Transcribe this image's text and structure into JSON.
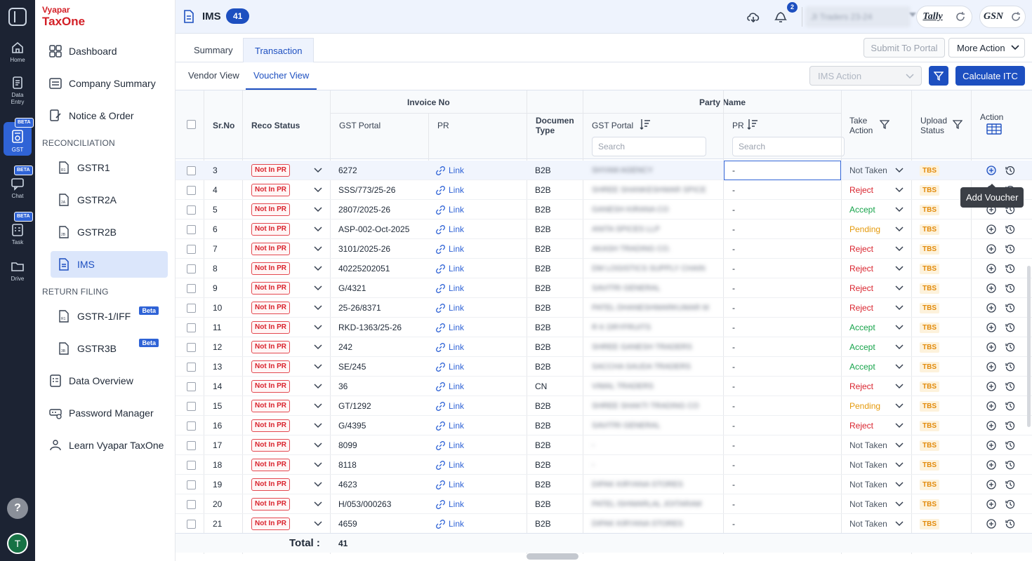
{
  "rail": {
    "items": [
      {
        "label": "Home",
        "icon": "home-icon"
      },
      {
        "label": "Data Entry",
        "icon": "data-entry-icon"
      },
      {
        "label": "GST",
        "icon": "gst-icon",
        "badge": "BETA"
      },
      {
        "label": "Chat",
        "icon": "chat-icon",
        "badge": "BETA"
      },
      {
        "label": "Task",
        "icon": "task-icon",
        "badge": "BETA"
      },
      {
        "label": "Drive",
        "icon": "drive-icon"
      }
    ],
    "help": "?",
    "avatar": "T"
  },
  "brand": {
    "line1": "Vyapar",
    "line2": "TaxOne"
  },
  "sidebar": {
    "dashboard": "Dashboard",
    "company_summary": "Company Summary",
    "notice_order": "Notice & Order",
    "reconciliation": "RECONCILIATION",
    "gstr1": "GSTR1",
    "gstr2a": "GSTR2A",
    "gstr2b": "GSTR2B",
    "ims": "IMS",
    "return_filing": "RETURN FILING",
    "gstr1_iff": "GSTR-1/IFF",
    "gstr3b": "GSTR3B",
    "beta": "Beta",
    "data_overview": "Data Overview",
    "password_manager": "Password Manager",
    "learn": "Learn Vyapar TaxOne"
  },
  "topbar": {
    "title": "IMS",
    "count": "41",
    "notifications": "2",
    "company": "JI Traders 23-24",
    "tally": "Tally",
    "gsn": "GSN"
  },
  "tabs": {
    "summary": "Summary",
    "transaction": "Transaction"
  },
  "actions": {
    "submit": "Submit To Portal",
    "more": "More Action",
    "ims_action": "IMS Action",
    "calculate": "Calculate ITC"
  },
  "views": {
    "vendor": "Vendor View",
    "voucher": "Voucher View"
  },
  "columns": {
    "srno": "Sr.No",
    "reco_status": "Reco Status",
    "invoice_no": "Invoice No",
    "gst_portal": "GST Portal",
    "pr": "PR",
    "doc_type_1": "Documen",
    "doc_type_2": "Type",
    "party_name": "Party Name",
    "take_action_1": "Take",
    "take_action_2": "Action",
    "upload_status_1": "Upload",
    "upload_status_2": "Status",
    "action": "Action",
    "search_placeholder": "Search"
  },
  "rows": [
    {
      "sr": "3",
      "reco": "Not In PR",
      "invoice": "6272",
      "pr": "Link",
      "doc": "B2B",
      "party": "SHYAM AGENCY",
      "party_pr": "-",
      "action": "Not Taken",
      "upload": "TBS"
    },
    {
      "sr": "4",
      "reco": "Not In PR",
      "invoice": "SSS/773/25-26",
      "pr": "Link",
      "doc": "B2B",
      "party": "SHREE SHANKESHWAR SPICE",
      "party_pr": "-",
      "action": "Reject",
      "upload": "TBS"
    },
    {
      "sr": "5",
      "reco": "Not In PR",
      "invoice": "2807/2025-26",
      "pr": "Link",
      "doc": "B2B",
      "party": "GANESH KIRANA CO",
      "party_pr": "-",
      "action": "Accept",
      "upload": "TBS"
    },
    {
      "sr": "6",
      "reco": "Not In PR",
      "invoice": "ASP-002-Oct-2025",
      "pr": "Link",
      "doc": "B2B",
      "party": "ANITA SPICES LLP",
      "party_pr": "-",
      "action": "Pending",
      "upload": "TBS"
    },
    {
      "sr": "7",
      "reco": "Not In PR",
      "invoice": "3101/2025-26",
      "pr": "Link",
      "doc": "B2B",
      "party": "AKASH TRADING CO.",
      "party_pr": "-",
      "action": "Reject",
      "upload": "TBS"
    },
    {
      "sr": "8",
      "reco": "Not In PR",
      "invoice": "40225202051",
      "pr": "Link",
      "doc": "B2B",
      "party": "DM LOGISTICS SUPPLY CHAIN",
      "party_pr": "-",
      "action": "Reject",
      "upload": "TBS"
    },
    {
      "sr": "9",
      "reco": "Not In PR",
      "invoice": "G/4321",
      "pr": "Link",
      "doc": "B2B",
      "party": "SAVITRI GENERAL",
      "party_pr": "-",
      "action": "Reject",
      "upload": "TBS"
    },
    {
      "sr": "10",
      "reco": "Not In PR",
      "invoice": "25-26/8371",
      "pr": "Link",
      "doc": "B2B",
      "party": "PATEL DHANESHWARKUMAR M",
      "party_pr": "-",
      "action": "Reject",
      "upload": "TBS"
    },
    {
      "sr": "11",
      "reco": "Not In PR",
      "invoice": "RKD-1363/25-26",
      "pr": "Link",
      "doc": "B2B",
      "party": "R K DRYFRUITS",
      "party_pr": "-",
      "action": "Accept",
      "upload": "TBS"
    },
    {
      "sr": "12",
      "reco": "Not In PR",
      "invoice": "242",
      "pr": "Link",
      "doc": "B2B",
      "party": "SHREE GANESH TRADERS",
      "party_pr": "-",
      "action": "Accept",
      "upload": "TBS"
    },
    {
      "sr": "13",
      "reco": "Not In PR",
      "invoice": "SE/245",
      "pr": "Link",
      "doc": "B2B",
      "party": "SACCHA SAUDA TRADERS",
      "party_pr": "-",
      "action": "Accept",
      "upload": "TBS"
    },
    {
      "sr": "14",
      "reco": "Not In PR",
      "invoice": "36",
      "pr": "Link",
      "doc": "CN",
      "party": "VIMAL TRADERS",
      "party_pr": "-",
      "action": "Reject",
      "upload": "TBS"
    },
    {
      "sr": "15",
      "reco": "Not In PR",
      "invoice": "GT/1292",
      "pr": "Link",
      "doc": "B2B",
      "party": "SHREE SHAKTI TRADING CO",
      "party_pr": "-",
      "action": "Pending",
      "upload": "TBS"
    },
    {
      "sr": "16",
      "reco": "Not In PR",
      "invoice": "G/4395",
      "pr": "Link",
      "doc": "B2B",
      "party": "SAVITRI GENERAL",
      "party_pr": "-",
      "action": "Reject",
      "upload": "TBS"
    },
    {
      "sr": "17",
      "reco": "Not In PR",
      "invoice": "8099",
      "pr": "Link",
      "doc": "B2B",
      "party": "-",
      "party_pr": "-",
      "action": "Not Taken",
      "upload": "TBS"
    },
    {
      "sr": "18",
      "reco": "Not In PR",
      "invoice": "8118",
      "pr": "Link",
      "doc": "B2B",
      "party": "-",
      "party_pr": "-",
      "action": "Not Taken",
      "upload": "TBS"
    },
    {
      "sr": "19",
      "reco": "Not In PR",
      "invoice": "4623",
      "pr": "Link",
      "doc": "B2B",
      "party": "DIPAK KIRYANA STORES",
      "party_pr": "-",
      "action": "Not Taken",
      "upload": "TBS"
    },
    {
      "sr": "20",
      "reco": "Not In PR",
      "invoice": "H/053/000263",
      "pr": "Link",
      "doc": "B2B",
      "party": "PATEL ISHWARLAL JOITARAM",
      "party_pr": "-",
      "action": "Not Taken",
      "upload": "TBS"
    },
    {
      "sr": "21",
      "reco": "Not In PR",
      "invoice": "4659",
      "pr": "Link",
      "doc": "B2B",
      "party": "DIPAK KIRYANA STORES",
      "party_pr": "-",
      "action": "Not Taken",
      "upload": "TBS"
    }
  ],
  "footer": {
    "total_label": "Total :",
    "total_value": "41"
  },
  "tooltip": "Add Voucher",
  "colors": {
    "accent": "#1d4fc0",
    "reject": "#d9232d",
    "accept": "#16a34a",
    "pending": "#e59a0c",
    "not_taken": "#4b5563"
  }
}
